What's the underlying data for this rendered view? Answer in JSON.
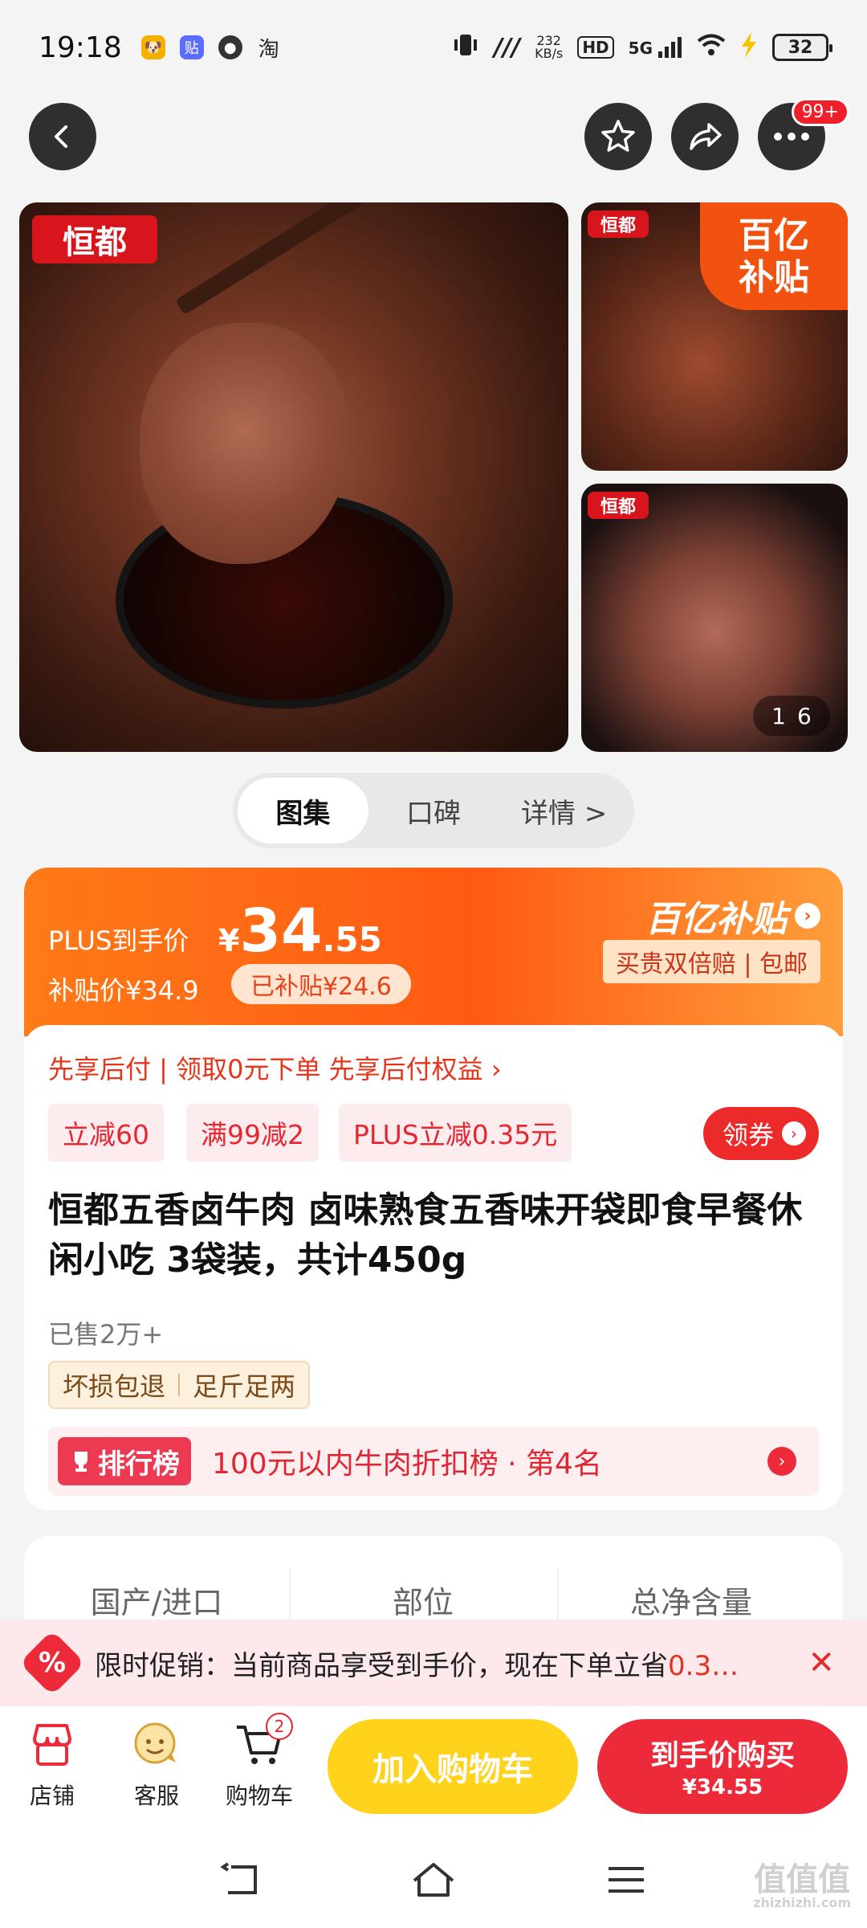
{
  "status_bar": {
    "time": "19:18",
    "apps": [
      "doge-icon",
      "tieba-icon",
      "chat-icon",
      "taobao-icon"
    ],
    "taobao_glyph": "淘",
    "net_speed_value": "232",
    "net_speed_unit": "KB/s",
    "hd_label": "HD",
    "signal_label": "5G",
    "battery": "32"
  },
  "nav": {
    "badge": "99+"
  },
  "gallery": {
    "brand": "恒都",
    "subsidy_line1": "百亿",
    "subsidy_line2": "补贴",
    "counter_current": "1",
    "counter_total": "6"
  },
  "tabs": [
    {
      "label": "图集",
      "active": true
    },
    {
      "label": "口碑",
      "active": false
    },
    {
      "label": "详情 >",
      "active": false
    }
  ],
  "price": {
    "plus_label": "PLUS到手价",
    "yen": "¥",
    "int": "34",
    "dec": ".55",
    "subsidy_price": "补贴价¥34.9",
    "subsidized": "已补贴¥24.6",
    "brand_title": "百亿补贴",
    "tag": "买贵双倍赔 | 包邮"
  },
  "product": {
    "pay_later": "先享后付 | 领取0元下单 先享后付权益 ›",
    "coupons": [
      "立减60",
      "满99减2",
      "PLUS立减0.35元"
    ],
    "get_coupon": "领券",
    "title": "恒都五香卤牛肉 卤味熟食五香味开袋即食早餐休闲小吃 3袋装，共计450g",
    "sold": "已售2万+",
    "guarantees": [
      "坏损包退",
      "足斤足两"
    ],
    "rank_badge": "排行榜",
    "rank_text": "100元以内牛肉折扣榜 · 第4名"
  },
  "specs": [
    "国产/进口",
    "部位",
    "总净含量"
  ],
  "promo": {
    "icon": "%",
    "text_prefix": "限时促销：当前商品享受到手价，现在下单立省",
    "text_highlight": "0.3…"
  },
  "bottom_bar": {
    "shop": "店铺",
    "service": "客服",
    "cart": "购物车",
    "cart_count": "2",
    "add_to_cart": "加入购物车",
    "buy_line1": "到手价购买",
    "buy_line2": "¥34.55"
  },
  "watermark": {
    "main": "值值值",
    "sub": "zhizhizhi.com"
  },
  "colors": {
    "accent": "#ec2a3a",
    "orange": "#ff5a12",
    "yellow": "#ffd21c"
  }
}
